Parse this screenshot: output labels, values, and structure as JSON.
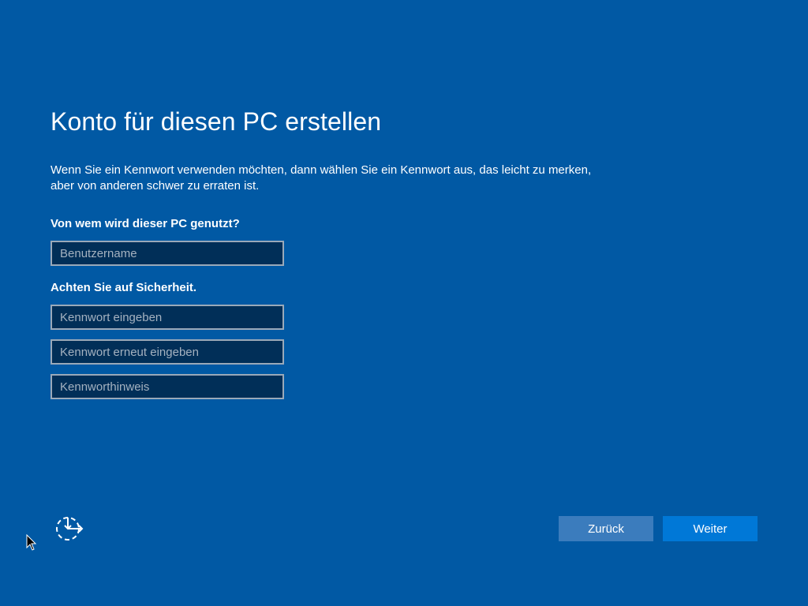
{
  "page": {
    "title": "Konto für diesen PC erstellen",
    "description": "Wenn Sie ein Kennwort verwenden möchten, dann wählen Sie ein Kennwort aus, das leicht zu merken, aber von anderen schwer zu erraten ist."
  },
  "form": {
    "user_section_label": "Von wem wird dieser PC genutzt?",
    "username": {
      "value": "",
      "placeholder": "Benutzername"
    },
    "security_section_label": "Achten Sie auf Sicherheit.",
    "password": {
      "value": "",
      "placeholder": "Kennwort eingeben"
    },
    "password_confirm": {
      "value": "",
      "placeholder": "Kennwort erneut eingeben"
    },
    "password_hint": {
      "value": "",
      "placeholder": "Kennworthinweis"
    }
  },
  "footer": {
    "ease_of_access_icon": "ease-of-access-icon",
    "back_label": "Zurück",
    "next_label": "Weiter"
  },
  "colors": {
    "background": "#0159a4",
    "field_background": "#012f58",
    "field_border": "#9aa9b9",
    "back_button": "#3b7cbd",
    "next_button": "#0078d7"
  }
}
